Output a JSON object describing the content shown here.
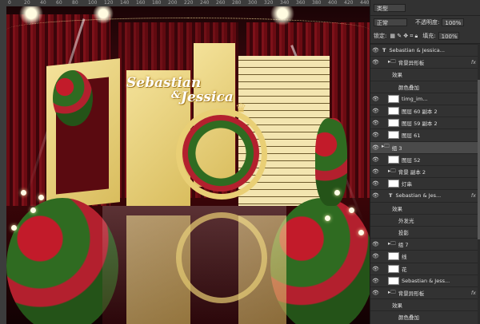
{
  "ruler": {
    "marks": [
      "0",
      "20",
      "40",
      "60",
      "80",
      "100",
      "120",
      "140",
      "160",
      "180",
      "200",
      "220",
      "240",
      "260",
      "280",
      "300",
      "320",
      "340",
      "360",
      "380",
      "400",
      "420",
      "440"
    ]
  },
  "canvas": {
    "title_line1": "Sebastian",
    "title_line2": "&",
    "title_line3": "Jessica"
  },
  "panel": {
    "filter_kind": "类型",
    "blend_mode": "正常",
    "opacity_label": "不透明度:",
    "opacity_value": "100%",
    "lock_label": "锁定:",
    "fill_label": "填充:",
    "fill_value": "100%",
    "layers": [
      {
        "name": "Sebastian & Jessica...",
        "type": "text",
        "indent": 0,
        "fx": false,
        "selected": false
      },
      {
        "name": "背景异形板",
        "type": "group",
        "indent": 1,
        "fx": true,
        "selected": false
      },
      {
        "name": "效果",
        "type": "effect",
        "indent": 2,
        "fx": false,
        "selected": false
      },
      {
        "name": "颜色叠加",
        "type": "effect",
        "indent": 3,
        "fx": false,
        "selected": false
      },
      {
        "name": "timg_im...",
        "type": "image",
        "indent": 1,
        "fx": false,
        "selected": false
      },
      {
        "name": "图层 60 副本 2",
        "type": "image",
        "indent": 1,
        "fx": false,
        "selected": false
      },
      {
        "name": "图层 59 副本 2",
        "type": "image",
        "indent": 1,
        "fx": false,
        "selected": false
      },
      {
        "name": "图层 61",
        "type": "image",
        "indent": 1,
        "fx": false,
        "selected": false
      },
      {
        "name": "组 3",
        "type": "group",
        "indent": 0,
        "fx": false,
        "selected": true
      },
      {
        "name": "图层 52",
        "type": "image",
        "indent": 1,
        "fx": false,
        "selected": false
      },
      {
        "name": "背景 副本 2",
        "type": "group",
        "indent": 1,
        "fx": false,
        "selected": false
      },
      {
        "name": "灯串",
        "type": "image",
        "indent": 1,
        "fx": false,
        "selected": false
      },
      {
        "name": "Sebastian & Jes...",
        "type": "text",
        "indent": 1,
        "fx": true,
        "selected": false
      },
      {
        "name": "效果",
        "type": "effect",
        "indent": 2,
        "fx": false,
        "selected": false
      },
      {
        "name": "外发光",
        "type": "effect",
        "indent": 3,
        "fx": false,
        "selected": false
      },
      {
        "name": "投影",
        "type": "effect",
        "indent": 3,
        "fx": false,
        "selected": false
      },
      {
        "name": "组 7",
        "type": "group",
        "indent": 1,
        "fx": false,
        "selected": false
      },
      {
        "name": "线",
        "type": "image",
        "indent": 1,
        "fx": false,
        "selected": false
      },
      {
        "name": "花",
        "type": "image",
        "indent": 1,
        "fx": false,
        "selected": false
      },
      {
        "name": "Sebastian & Jess...",
        "type": "image",
        "indent": 1,
        "fx": false,
        "selected": false
      },
      {
        "name": "背景异形板",
        "type": "group",
        "indent": 1,
        "fx": true,
        "selected": false
      },
      {
        "name": "效果",
        "type": "effect",
        "indent": 2,
        "fx": false,
        "selected": false
      },
      {
        "name": "颜色叠加",
        "type": "effect",
        "indent": 3,
        "fx": false,
        "selected": false
      }
    ]
  }
}
